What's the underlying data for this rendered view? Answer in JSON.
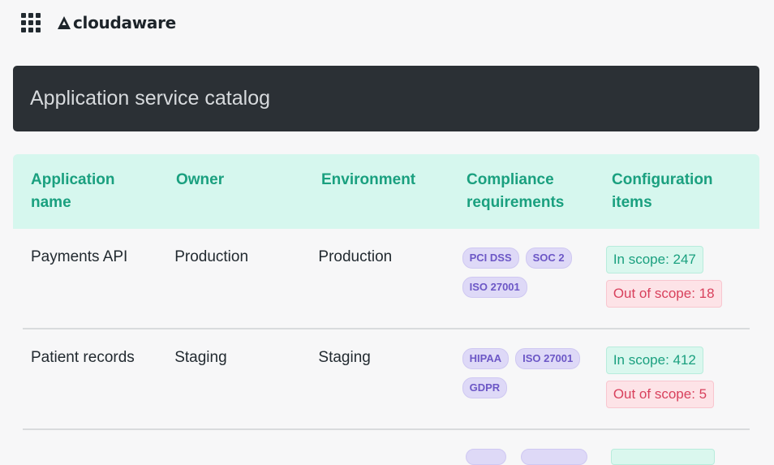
{
  "app": {
    "brand": "cloudaware",
    "apps_icon": "grid-apps-icon"
  },
  "banner": {
    "title": "Application service catalog"
  },
  "table": {
    "columns": [
      "Application\nname",
      "Owner",
      "Environment",
      "Compliance\nrequirements",
      "Configuration\nitems"
    ],
    "rows": [
      {
        "name": "Payments API",
        "owner": "Production",
        "environment": "Production",
        "compliance": [
          "PCI DSS",
          "SOC 2",
          "ISO 27001"
        ],
        "in_scope": "In scope: 247",
        "out_of_scope": "Out of scope: 18"
      },
      {
        "name": "Patient records",
        "owner": "Staging",
        "environment": "Staging",
        "compliance": [
          "HIPAA",
          "ISO 27001",
          "GDPR"
        ],
        "in_scope": "In scope: 412",
        "out_of_scope": "Out of scope: 5"
      }
    ]
  },
  "colors": {
    "header_bg": "#d6f7ee",
    "header_text": "#1aa07f",
    "banner_bg": "#2b3035",
    "tag_bg": "#ded9f7",
    "tag_text": "#6c57c6",
    "in_scope_text": "#1aa07f",
    "out_scope_text": "#d8405c"
  }
}
